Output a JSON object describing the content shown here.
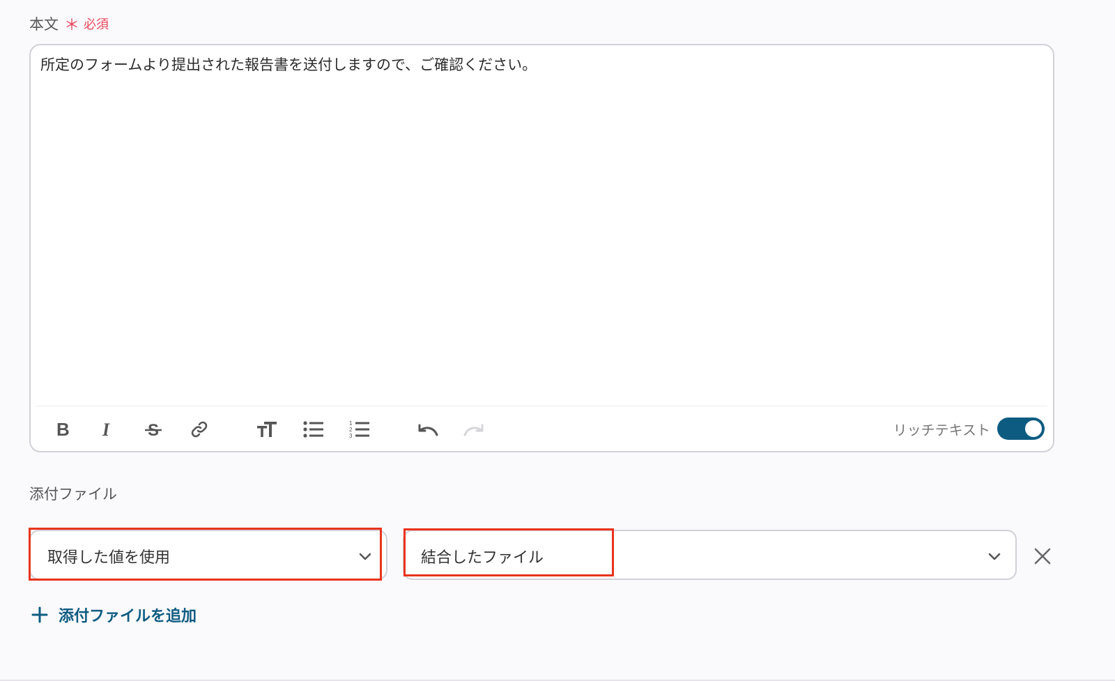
{
  "body_field": {
    "label": "本文",
    "required_mark": "＊",
    "required_text": "必須",
    "content": "所定のフォームより提出された報告書を送付しますので、ご確認ください。"
  },
  "toolbar": {
    "buttons": [
      "bold-icon",
      "italic-icon",
      "strikethrough-icon",
      "link-icon",
      "text-size-icon",
      "bulleted-list-icon",
      "numbered-list-icon",
      "undo-icon",
      "redo-icon"
    ],
    "rich_text_label": "リッチテキスト",
    "rich_text_enabled": true
  },
  "attachment": {
    "label": "添付ファイル",
    "source_select_value": "取得した値を使用",
    "file_select_value": "結合したファイル",
    "add_label": "添付ファイルを追加"
  },
  "colors": {
    "accent": "#0d5b81",
    "required": "#e8465a",
    "highlight": "#e8341c"
  }
}
